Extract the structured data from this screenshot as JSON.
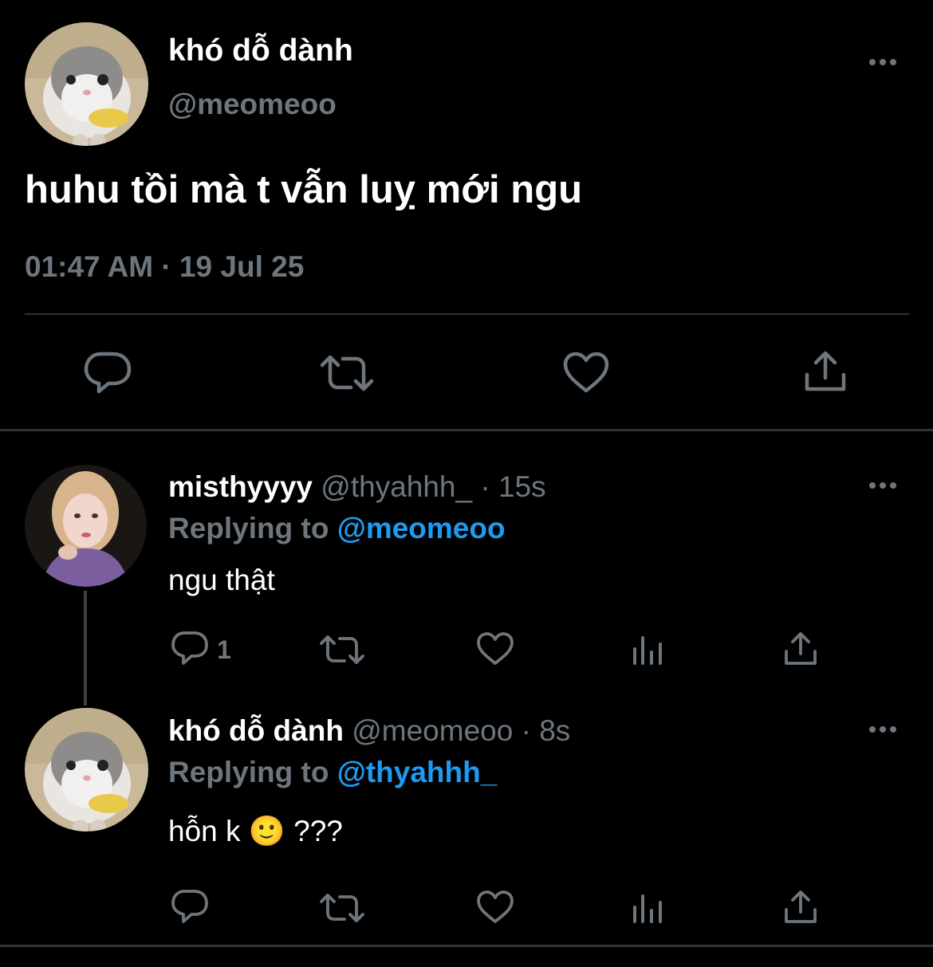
{
  "main_tweet": {
    "display_name": "khó dỗ dành",
    "handle": "@meomeoo",
    "text": "huhu tồi mà t vẫn luỵ mới ngu",
    "timestamp": "01:47 AM · 19 Jul 25",
    "actions": [
      "reply-icon",
      "retweet-icon",
      "like-icon",
      "share-icon"
    ]
  },
  "replies": [
    {
      "display_name": "misthyyyy",
      "handle_time": "@thyahhh_ · 15s",
      "replying_prefix": "Replying to",
      "replying_to": "@meomeoo",
      "text": "ngu thật",
      "reply_count": "1"
    },
    {
      "display_name": "khó dỗ dành",
      "handle_time": "@meomeoo · 8s",
      "replying_prefix": "Replying to",
      "replying_to": "@thyahhh_",
      "text": "hỗn k 🙂 ???",
      "reply_count": ""
    }
  ],
  "colors": {
    "background": "#000000",
    "text": "#ffffff",
    "muted": "#6e767d",
    "link": "#1d9bf0",
    "divider": "#2f3336"
  }
}
